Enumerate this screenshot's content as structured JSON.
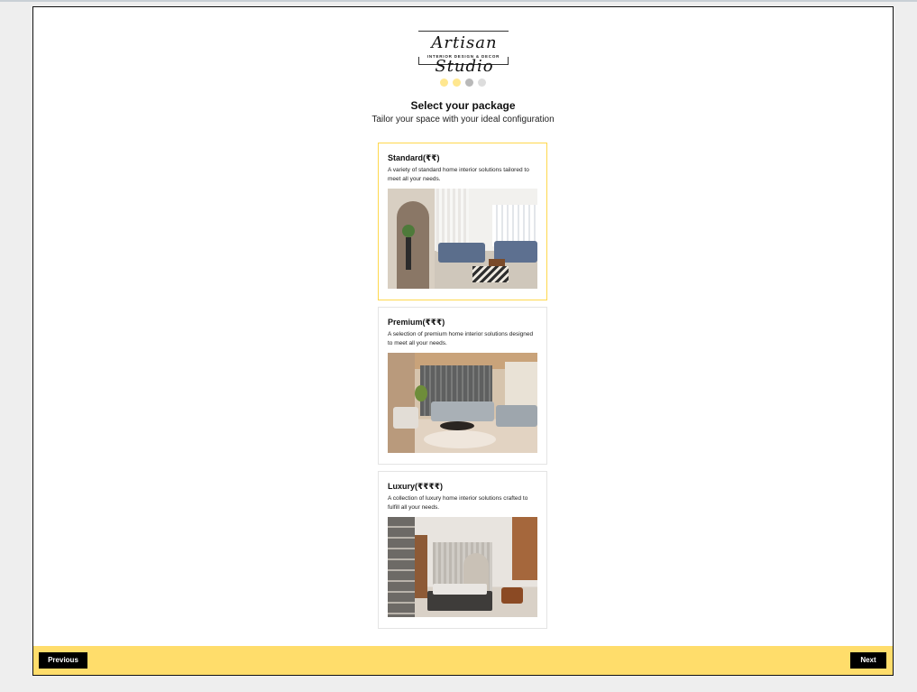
{
  "brand": {
    "logo_script": "Artisan Studio",
    "logo_tagline": "INTERIOR DESIGN & DECOR"
  },
  "progress": {
    "total_steps": 4,
    "current_step": 3,
    "step_colors": [
      "#ffe78f",
      "#ffe78f",
      "#b9b9b9",
      "#dddddd"
    ]
  },
  "header": {
    "title": "Select your package",
    "subtitle": "Tailor your space with your ideal configuration"
  },
  "packages": [
    {
      "name": "Standard(₹₹)",
      "description": "A variety of standard home interior solutions tailored to meet all your needs.",
      "image_icon": "living-room-photo",
      "selected": true
    },
    {
      "name": "Premium(₹₹₹)",
      "description": "A selection of premium home interior solutions designed to meet all your needs.",
      "image_icon": "lounge-photo",
      "selected": false
    },
    {
      "name": "Luxury(₹₹₹₹)",
      "description": "A collection of luxury home interior solutions crafted to fulfill all your needs.",
      "image_icon": "bedroom-photo",
      "selected": false
    }
  ],
  "navigation": {
    "previous_label": "Previous",
    "next_label": "Next"
  },
  "colors": {
    "accent": "#ffdd6b",
    "selected_border": "#ffd84d",
    "button_bg": "#000000"
  }
}
